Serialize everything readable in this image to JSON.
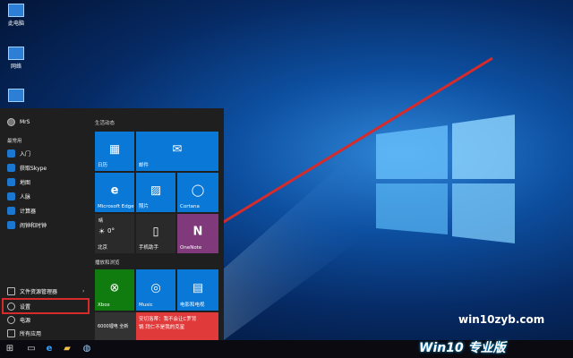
{
  "desktop_icons": [
    {
      "label": "此电脑"
    },
    {
      "label": "网络"
    }
  ],
  "start_menu": {
    "user": "MrS",
    "most_used_title": "最常用",
    "items": [
      "入门",
      "获取Skype",
      "地图",
      "人脉",
      "计算器",
      "闹钟和时钟"
    ],
    "bottom": {
      "explorer": "文件资源管理器",
      "settings": "设置",
      "power": "电源",
      "all_apps": "所有应用"
    },
    "life_title": "生活动态",
    "play_title": "播放和浏览"
  },
  "tiles": {
    "calendar": "日历",
    "mail": "邮件",
    "edge": "Microsoft Edge",
    "photos": "照片",
    "cortana": "Cortana",
    "weather_desc": "晴",
    "weather_temp": "0°",
    "weather_city": "北京",
    "phone": "手机助手",
    "onenote": "OneNote",
    "xbox": "Xbox",
    "music": "Music",
    "movies": "电影和电视",
    "news_line1": "安切洛蒂：我不会让C罗背",
    "news_line2": "锅 拜仁不是我的克星",
    "news_side": "6000锂电 全新"
  },
  "watermark": {
    "site": "win10zyb.com",
    "logo": "Win10 专业版"
  },
  "colors": {
    "tile_blue": "#0a78d7",
    "xbox_green": "#107c10",
    "onenote_purple": "#80397b",
    "news_red": "#e03a3a",
    "highlight_red": "#d62b2b"
  }
}
